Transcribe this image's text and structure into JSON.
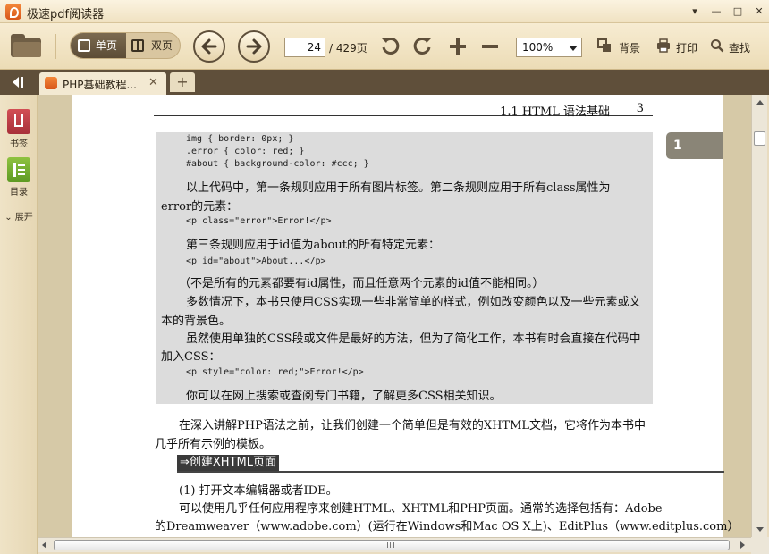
{
  "window": {
    "title": "极速pdf阅读器",
    "controls": [
      "▾",
      "—",
      "□",
      "✕"
    ]
  },
  "toolbar": {
    "view_single": "单页",
    "view_double": "双页",
    "current_page": "24",
    "total_pages": "/ 429页",
    "zoom": "100%",
    "background": "背景",
    "print": "打印",
    "find": "查找"
  },
  "tabs": [
    {
      "label": "PHP基础教程...",
      "close": "✕"
    }
  ],
  "tab_add": "+",
  "left_panel": {
    "bookmarks": "书签",
    "toc": "目录",
    "expand": "展开"
  },
  "document": {
    "header_title": "1.1   HTML 语法基础",
    "header_page": "3",
    "code_lines": [
      "img { border: 0px; }",
      ".error { color: red; }",
      "#about { background-color: #ccc; }"
    ],
    "para1_line1": "以上代码中，第一条规则应用于所有图片标签。第二条规则应用于所有class属性为",
    "para1_line2": "error的元素：",
    "code2": "<p class=\"error\">Error!</p>",
    "para2": "第三条规则应用于id值为about的所有特定元素：",
    "code3": "<p id=\"about\">About...</p>",
    "para3": "（不是所有的元素都要有id属性，而且任意两个元素的id值不能相同。）",
    "para4_line1": "多数情况下，本书只使用CSS实现一些非常简单的样式，例如改变颜色以及一些元素或文",
    "para4_line2": "本的背景色。",
    "para5_line1": "虽然使用单独的CSS段或文件是最好的方法，但为了简化工作，本书有时会直接在代码中",
    "para5_line2": "加入CSS：",
    "code4": "<p style=\"color: red;\">Error!</p>",
    "para6": "你可以在网上搜索或查阅专门书籍，了解更多CSS相关知识。",
    "para7_line1": "在深入讲解PHP语法之前，让我们创建一个简单但是有效的XHTML文档，它将作为本书中",
    "para7_line2": "几乎所有示例的模板。",
    "section_heading": "⇒创建XHTML页面",
    "step1": "(1) 打开文本编辑器或者IDE。",
    "para8_line1": "可以使用几乎任何应用程序来创建HTML、XHTML和PHP页面。通常的选择包括有：Adobe",
    "para8_line2": "的Dreamweaver（www.adobe.com）(运行在Windows和Mac OS X上)、EditPlus（www.editplus.com）"
  },
  "bookmark_marker": "1",
  "colors": {
    "accent_orange": "#e46a25",
    "toolbar_bg": "#f3e6c6",
    "tabbar_bg": "#5f4f3a",
    "code_bg": "#dcdcdc"
  }
}
